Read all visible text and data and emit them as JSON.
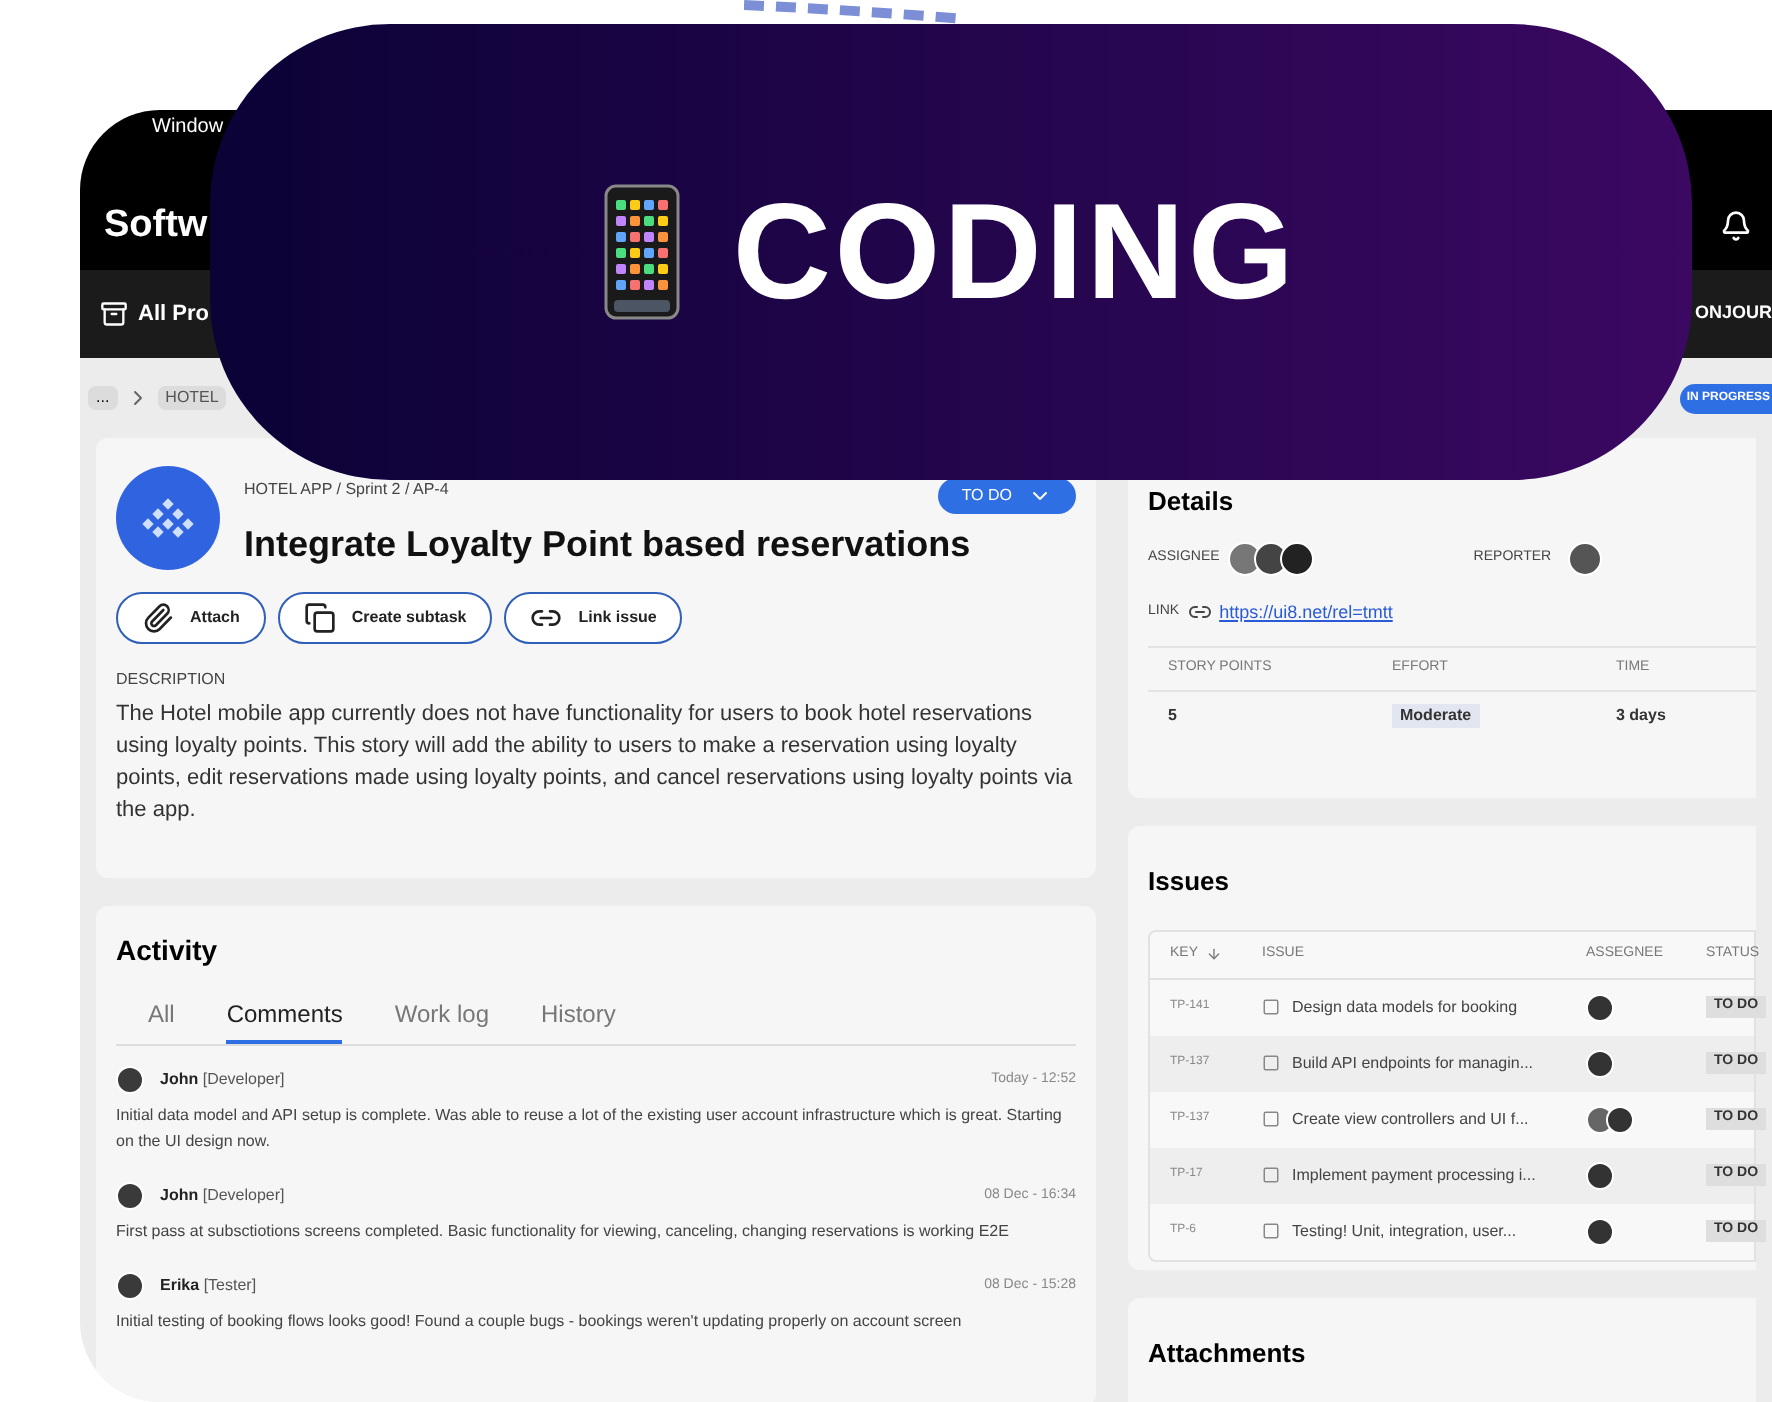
{
  "status_bar": {
    "text": "Window"
  },
  "app_title": "Softw",
  "nav": {
    "label": "All Pro",
    "user": "ONJOUR"
  },
  "breadcrumb": {
    "more": "...",
    "item": "HOTEL"
  },
  "status_button": {
    "label": "IN PROGRESS"
  },
  "banner": {
    "title": "CODING"
  },
  "issue": {
    "path": "HOTEL APP / Sprint 2 / AP-4",
    "title": "Integrate Loyalty Point based reservations",
    "status": "TO DO",
    "actions": [
      {
        "label": "Attach",
        "kind": "attach"
      },
      {
        "label": "Create subtask",
        "kind": "subtask"
      },
      {
        "label": "Link issue",
        "kind": "link"
      }
    ],
    "description_label": "DESCRIPTION",
    "description": "The Hotel mobile app currently does not have functionality for users to book hotel reservations using loyalty points.  This story will add the ability to users to make a reservation using loyalty points, edit reservations made using loyalty points, and cancel reservations using loyalty points via the app."
  },
  "activity": {
    "title": "Activity",
    "tabs": [
      {
        "label": "All",
        "selected": false
      },
      {
        "label": "Comments",
        "selected": true
      },
      {
        "label": "Work log",
        "selected": false
      },
      {
        "label": "History",
        "selected": false
      }
    ],
    "comments": [
      {
        "author": "John",
        "role": "[Developer]",
        "time": "Today - 12:52",
        "text": "Initial data model and API setup is complete. Was able to reuse a lot of the existing user account infrastructure which is great. Starting on the UI design now."
      },
      {
        "author": "John",
        "role": "[Developer]",
        "time": "08 Dec - 16:34",
        "text": "First pass at subsctiotions screens completed. Basic functionality for viewing, canceling, changing reservations is working E2E"
      },
      {
        "author": "Erika",
        "role": "[Tester]",
        "time": "08 Dec - 15:28",
        "text": "Initial testing of booking flows looks good! Found a couple bugs - bookings weren't updating properly on account screen"
      }
    ]
  },
  "details": {
    "title": "Details",
    "assignee_label": "ASSIGNEE",
    "reporter_label": "REPORTER",
    "link_label": "LINK",
    "link": "https://ui8.net/rel=tmtt",
    "columns": [
      "STORY POINTS",
      "EFFORT",
      "TIME"
    ],
    "values": [
      "5",
      "Moderate",
      "3 days"
    ]
  },
  "issues": {
    "title": "Issues",
    "columns": [
      "KEY",
      "ISSUE",
      "ASSEGNEE",
      "STATUS"
    ],
    "rows": [
      {
        "key": "TP-141",
        "issue": "Design data models for booking",
        "kind": "single",
        "status": "TO DO"
      },
      {
        "key": "TP-137",
        "issue": "Build API endpoints for managin...",
        "kind": "single",
        "status": "TO DO"
      },
      {
        "key": "TP-137",
        "issue": "Create view controllers and UI f...",
        "kind": "pair",
        "status": "TO DO"
      },
      {
        "key": "TP-17",
        "issue": "Implement payment processing i...",
        "kind": "single",
        "status": "TO DO"
      },
      {
        "key": "TP-6",
        "issue": "Testing! Unit, integration, user...",
        "kind": "single",
        "status": "TO DO"
      }
    ]
  },
  "attachments": {
    "title": "Attachments"
  }
}
